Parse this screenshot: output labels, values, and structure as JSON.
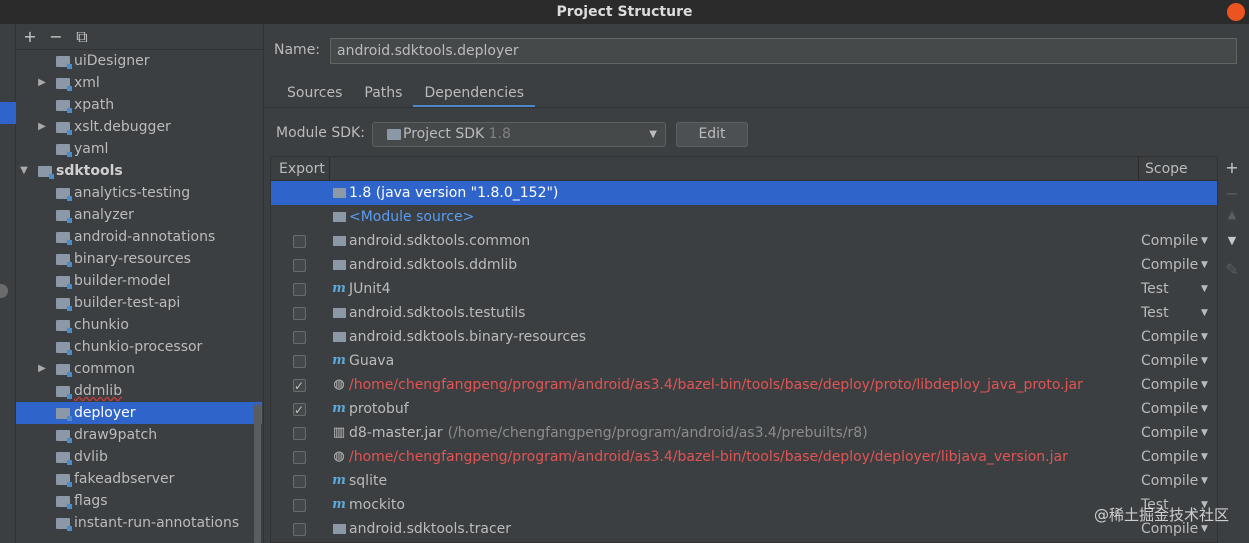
{
  "window": {
    "title": "Project Structure"
  },
  "tree": {
    "toolbar": {
      "add": "+",
      "remove": "−",
      "copy": "⧉"
    },
    "items": [
      {
        "label": "uiDesigner",
        "level": 1,
        "expandable": false
      },
      {
        "label": "xml",
        "level": 1,
        "expandable": true
      },
      {
        "label": "xpath",
        "level": 1,
        "expandable": false
      },
      {
        "label": "xslt.debugger",
        "level": 1,
        "expandable": true
      },
      {
        "label": "yaml",
        "level": 1,
        "expandable": false
      },
      {
        "label": "sdktools",
        "level": 0,
        "expandable": true,
        "expanded": true,
        "bold": true
      },
      {
        "label": "analytics-testing",
        "level": 1,
        "expandable": false
      },
      {
        "label": "analyzer",
        "level": 1,
        "expandable": false
      },
      {
        "label": "android-annotations",
        "level": 1,
        "expandable": false
      },
      {
        "label": "binary-resources",
        "level": 1,
        "expandable": false
      },
      {
        "label": "builder-model",
        "level": 1,
        "expandable": false
      },
      {
        "label": "builder-test-api",
        "level": 1,
        "expandable": false
      },
      {
        "label": "chunkio",
        "level": 1,
        "expandable": false
      },
      {
        "label": "chunkio-processor",
        "level": 1,
        "expandable": false
      },
      {
        "label": "common",
        "level": 1,
        "expandable": true
      },
      {
        "label": "ddmlib",
        "level": 1,
        "expandable": false,
        "squiggle": true
      },
      {
        "label": "deployer",
        "level": 1,
        "expandable": false,
        "selected": true
      },
      {
        "label": "draw9patch",
        "level": 1,
        "expandable": false
      },
      {
        "label": "dvlib",
        "level": 1,
        "expandable": false
      },
      {
        "label": "fakeadbserver",
        "level": 1,
        "expandable": false
      },
      {
        "label": "flags",
        "level": 1,
        "expandable": false
      },
      {
        "label": "instant-run-annotations",
        "level": 1,
        "expandable": false
      }
    ]
  },
  "module": {
    "name_label": "Name:",
    "name_value": "android.sdktools.deployer",
    "tabs": [
      "Sources",
      "Paths",
      "Dependencies"
    ],
    "active_tab": 2,
    "sdk_label": "Module SDK:",
    "sdk_value": "Project SDK",
    "sdk_version": "1.8",
    "edit_label": "Edit"
  },
  "deps": {
    "header_export": "Export",
    "header_scope": "Scope",
    "rows": [
      {
        "icon": "folder",
        "name": "1.8 (java version \"1.8.0_152\")",
        "checkbox": false,
        "checked": false,
        "scope": "",
        "style": "selected"
      },
      {
        "icon": "folder",
        "name": "<Module source>",
        "checkbox": false,
        "checked": false,
        "scope": "",
        "style": "link"
      },
      {
        "icon": "folder",
        "name": "android.sdktools.common",
        "checkbox": true,
        "checked": false,
        "scope": "Compile",
        "style": ""
      },
      {
        "icon": "folder",
        "name": "android.sdktools.ddmlib",
        "checkbox": true,
        "checked": false,
        "scope": "Compile",
        "style": ""
      },
      {
        "icon": "m",
        "name": "JUnit4",
        "checkbox": true,
        "checked": false,
        "scope": "Test",
        "style": ""
      },
      {
        "icon": "folder",
        "name": "android.sdktools.testutils",
        "checkbox": true,
        "checked": false,
        "scope": "Test",
        "style": ""
      },
      {
        "icon": "folder",
        "name": "android.sdktools.binary-resources",
        "checkbox": true,
        "checked": false,
        "scope": "Compile",
        "style": ""
      },
      {
        "icon": "m",
        "name": "Guava",
        "checkbox": true,
        "checked": false,
        "scope": "Compile",
        "style": ""
      },
      {
        "icon": "globe",
        "name": "/home/chengfangpeng/program/android/as3.4/bazel-bin/tools/base/deploy/proto/libdeploy_java_proto.jar",
        "checkbox": true,
        "checked": true,
        "scope": "Compile",
        "style": "red"
      },
      {
        "icon": "m",
        "name": "protobuf",
        "checkbox": true,
        "checked": true,
        "scope": "Compile",
        "style": ""
      },
      {
        "icon": "jar",
        "name": "d8-master.jar",
        "path": "(/home/chengfangpeng/program/android/as3.4/prebuilts/r8)",
        "checkbox": true,
        "checked": false,
        "scope": "Compile",
        "style": ""
      },
      {
        "icon": "globe",
        "name": "/home/chengfangpeng/program/android/as3.4/bazel-bin/tools/base/deploy/deployer/libjava_version.jar",
        "checkbox": true,
        "checked": false,
        "scope": "Compile",
        "style": "red"
      },
      {
        "icon": "m",
        "name": "sqlite",
        "checkbox": true,
        "checked": false,
        "scope": "Compile",
        "style": ""
      },
      {
        "icon": "m",
        "name": "mockito",
        "checkbox": true,
        "checked": false,
        "scope": "Test",
        "style": ""
      },
      {
        "icon": "folder",
        "name": "android.sdktools.tracer",
        "checkbox": true,
        "checked": false,
        "scope": "Compile",
        "style": ""
      }
    ]
  },
  "side_tools": {
    "add": "+",
    "remove": "−",
    "down": "▼",
    "edit": "✎"
  },
  "watermark": "@稀土掘金技术社区"
}
